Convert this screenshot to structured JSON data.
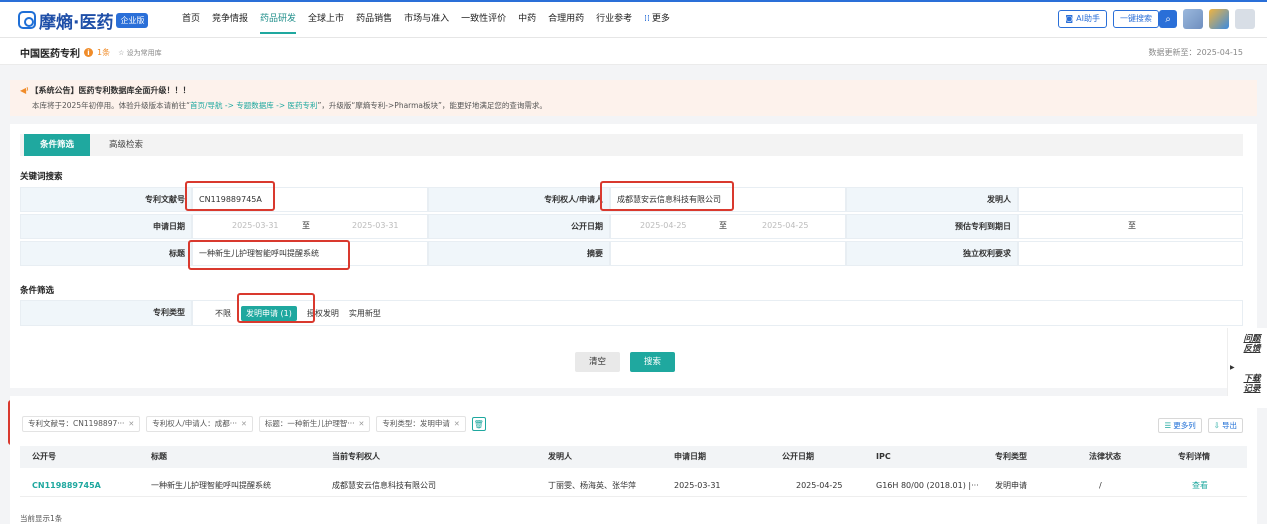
{
  "brand": {
    "name": "摩熵·医药",
    "edition": "企业版"
  },
  "nav": [
    {
      "label": "首页"
    },
    {
      "label": "竞争情报"
    },
    {
      "label": "药品研发",
      "active": true
    },
    {
      "label": "全球上市"
    },
    {
      "label": "药品销售"
    },
    {
      "label": "市场与准入"
    },
    {
      "label": "一致性评价"
    },
    {
      "label": "中药"
    },
    {
      "label": "合理用药"
    },
    {
      "label": "行业参考"
    },
    {
      "label": "更多"
    }
  ],
  "tools": {
    "ai": "AI助手",
    "quick_search": "一键搜索"
  },
  "page": {
    "title": "中国医药专利",
    "count_icon": "i",
    "count": "1条",
    "fav": "设为常用库",
    "update": "数据更新至：2025-04-15"
  },
  "notice": {
    "line1": "【系统公告】医药专利数据库全面升级！！！",
    "line2_a": "本库将于2025年初停用。体验升级版本请前往“",
    "line2_link": "首页/导航 -> 专题数据库 -> 医药专利",
    "line2_b": "”，升级版“摩熵专利->Pharma板块”，能更好地满足您的查询需求。"
  },
  "tabs": {
    "active": "条件筛选",
    "other": "高级检索"
  },
  "keyword": {
    "section": "关键词搜索",
    "doc_no_label": "专利文献号",
    "doc_no": "CN119889745A",
    "owner_label": "专利权人/申请人",
    "owner": "成都慧安云信息科技有限公司",
    "inventor_label": "发明人",
    "inventor": "",
    "apply_date_label": "申请日期",
    "apply_from": "2025-03-31",
    "apply_to": "2025-03-31",
    "pub_date_label": "公开日期",
    "pub_from": "2025-04-25",
    "pub_to": "2025-04-25",
    "expire_label": "预估专利到期日",
    "range_sep": "至",
    "title_label": "标题",
    "title": "一种新生儿护理智能呼叫提醒系统",
    "abstract_label": "摘要",
    "claims_label": "独立权利要求"
  },
  "filter": {
    "section": "条件筛选",
    "type_label": "专利类型",
    "options": [
      {
        "label": "不限"
      },
      {
        "label": "发明申请 (1)",
        "selected": true
      },
      {
        "label": "授权发明"
      },
      {
        "label": "实用新型"
      }
    ]
  },
  "actions": {
    "clear": "清空",
    "search": "搜索"
  },
  "side": {
    "feedback": "问题反馈",
    "download": "下载记录"
  },
  "chips": [
    "专利文献号：CN1198897···",
    "专利权人/申请人：成都···",
    "标题：一种新生儿护理智···",
    "专利类型：发明申请"
  ],
  "result_tools": {
    "more_cols": "更多列",
    "export": "导出"
  },
  "table": {
    "headers": [
      "公开号",
      "标题",
      "当前专利权人",
      "发明人",
      "申请日期",
      "公开日期",
      "IPC",
      "专利类型",
      "法律状态",
      "专利详情"
    ],
    "rows": [
      [
        "CN119889745A",
        "一种新生儿护理智能呼叫提醒系统",
        "成都慧安云信息科技有限公司",
        "丁丽雯、杨海英、张华萍",
        "2025-03-31",
        "2025-04-25",
        "G16H 80/00 (2018.01) |···",
        "发明申请",
        "/",
        "查看"
      ]
    ]
  },
  "footer": "当前显示1条",
  "colors": {
    "accent": "#1fa89f",
    "brand": "#2a6fd8",
    "highlight": "#d9392e"
  }
}
